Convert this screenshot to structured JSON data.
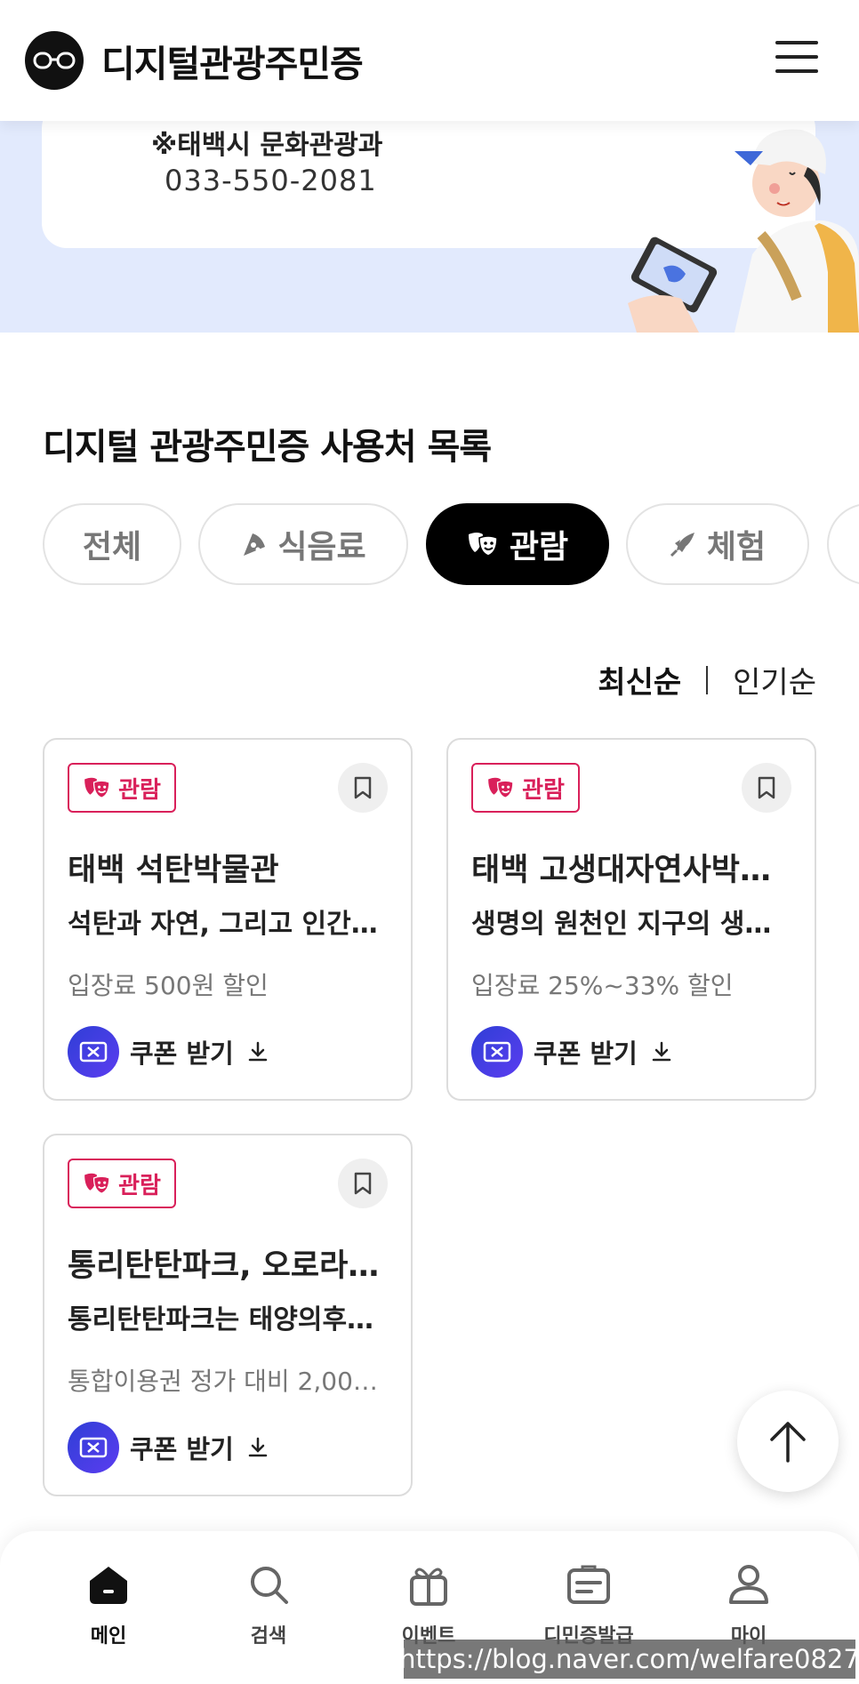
{
  "header": {
    "brand": "디지털관광주민증"
  },
  "hero": {
    "department": "※태백시 문화관광과",
    "phone": "033-550-2081"
  },
  "section": {
    "title": "디지털 관광주민증 사용처 목록"
  },
  "chips": [
    {
      "label": "전체",
      "icon": ""
    },
    {
      "label": "식음료",
      "icon": "pizza-icon"
    },
    {
      "label": "관람",
      "icon": "theater-mask-icon",
      "active": true
    },
    {
      "label": "체험",
      "icon": "rocket-icon"
    }
  ],
  "sort": {
    "latest": "최신순",
    "popular": "인기순"
  },
  "cards": [
    {
      "badge": "관람",
      "title": "태백 석탄박물관",
      "desc": "석탄과 자연, 그리고 인간…",
      "benefit": "입장료 500원 할인",
      "coupon": "쿠폰 받기"
    },
    {
      "badge": "관람",
      "title": "태백 고생대자연사박…",
      "desc": "생명의 원천인 지구의 생…",
      "benefit": "입장료 25%~33% 할인",
      "coupon": "쿠폰 받기"
    },
    {
      "badge": "관람",
      "title": "통리탄탄파크, 오로라…",
      "desc": "통리탄탄파크는 태양의후…",
      "benefit": "통합이용권 정가 대비 2,00…",
      "coupon": "쿠폰 받기"
    }
  ],
  "nav": [
    {
      "label": "메인",
      "icon": "home-icon",
      "active": true
    },
    {
      "label": "검색",
      "icon": "search-icon"
    },
    {
      "label": "이벤트",
      "icon": "gift-icon"
    },
    {
      "label": "디민증발급",
      "icon": "id-card-icon"
    },
    {
      "label": "마이",
      "icon": "person-icon"
    }
  ],
  "watermark": "https://blog.naver.com/welfare0827",
  "colors": {
    "accent_pink": "#d9205a",
    "hero_bg": "#e2eafd",
    "coupon_blue": "#2f3ed6"
  }
}
